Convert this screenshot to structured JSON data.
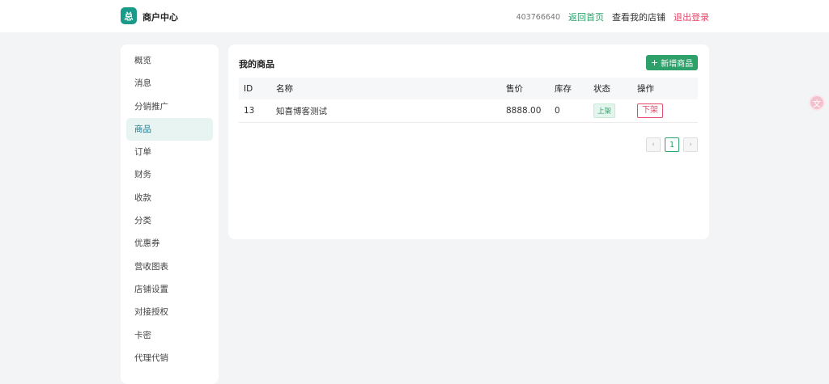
{
  "brand": {
    "logo_char": "总",
    "title": "商户中心"
  },
  "topnav": {
    "uid": "403766640",
    "home": "返回首页",
    "shop": "查看我的店铺",
    "logout": "退出登录"
  },
  "sidebar": {
    "items": [
      {
        "label": "概览"
      },
      {
        "label": "消息"
      },
      {
        "label": "分销推广"
      },
      {
        "label": "商品",
        "active": true
      },
      {
        "label": "订单"
      },
      {
        "label": "财务"
      },
      {
        "label": "收款"
      },
      {
        "label": "分类"
      },
      {
        "label": "优惠券"
      },
      {
        "label": "营收图表"
      },
      {
        "label": "店铺设置"
      },
      {
        "label": "对接授权"
      },
      {
        "label": "卡密"
      },
      {
        "label": "代理代销"
      }
    ]
  },
  "main": {
    "title": "我的商品",
    "add_button": "新增商品",
    "add_icon": "+",
    "columns": [
      "ID",
      "名称",
      "售价",
      "库存",
      "状态",
      "操作"
    ],
    "rows": [
      {
        "id": "13",
        "name": "知喜博客测试",
        "price": "8888.00",
        "stock": "0",
        "status": "上架",
        "action": "下架"
      }
    ],
    "pager": {
      "prev": "‹",
      "current": "1",
      "next": "›"
    }
  },
  "float_button": {
    "icon": "translate-icon",
    "glyph": "文"
  },
  "colors": {
    "accent": "#2ea16a",
    "danger": "#e64a6b",
    "logo": "#1a9b8a"
  }
}
